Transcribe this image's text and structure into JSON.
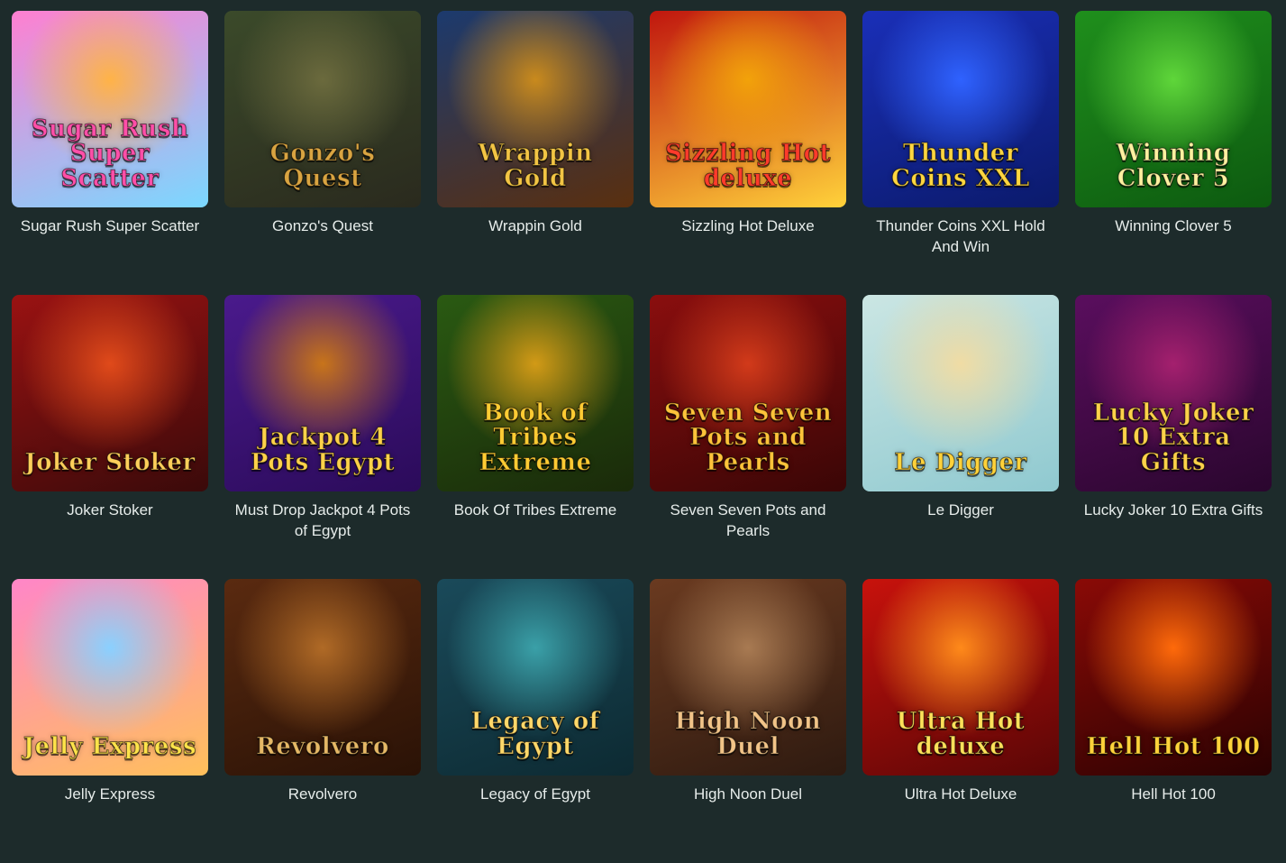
{
  "games": [
    {
      "title": "Sugar Rush Super Scatter",
      "logo": "Sugar Rush Super Scatter",
      "icon": "candy-sun-icon",
      "colors": [
        "#ff7fd0",
        "#ffb347",
        "#7ad8ff"
      ],
      "logo_color": "#ff4fa8"
    },
    {
      "title": "Gonzo's Quest",
      "logo": "Gonzo's Quest",
      "icon": "explorer-icon",
      "colors": [
        "#3b4a2a",
        "#6b6a3d",
        "#2a2a1e"
      ],
      "logo_color": "#d9a441"
    },
    {
      "title": "Wrappin Gold",
      "logo": "Wrappin Gold",
      "icon": "mummy-icon",
      "colors": [
        "#1c3a6e",
        "#c98a1d",
        "#5a2f0f"
      ],
      "logo_color": "#f3c544"
    },
    {
      "title": "Sizzling Hot Deluxe",
      "logo": "Sizzling Hot deluxe",
      "icon": "seven-cherries-icon",
      "colors": [
        "#c0160e",
        "#f2a20a",
        "#ffd23a"
      ],
      "logo_color": "#ff3b2b"
    },
    {
      "title": "Thunder Coins XXL Hold And Win",
      "logo": "Thunder Coins XXL",
      "icon": "lightning-coin-icon",
      "colors": [
        "#1a2fb8",
        "#2f62ff",
        "#0b1a6b"
      ],
      "logo_color": "#ffd640"
    },
    {
      "title": "Winning Clover 5",
      "logo": "Winning Clover 5",
      "icon": "clover-icon",
      "colors": [
        "#1f8f1c",
        "#5fd63a",
        "#0d5a10"
      ],
      "logo_color": "#fff1a0"
    },
    {
      "title": "Joker Stoker",
      "logo": "Joker Stoker",
      "icon": "joker-icon",
      "colors": [
        "#9a1212",
        "#e04a1a",
        "#3a0a0a"
      ],
      "logo_color": "#ffcf5a"
    },
    {
      "title": "Must Drop Jackpot 4 Pots of Egypt",
      "logo": "Jackpot 4 Pots Egypt",
      "icon": "gold-pot-icon",
      "colors": [
        "#4a1a8c",
        "#c8741a",
        "#2b0b5a"
      ],
      "logo_color": "#ffd24a"
    },
    {
      "title": "Book Of Tribes Extreme",
      "logo": "Book of Tribes Extreme",
      "icon": "book-icon",
      "colors": [
        "#2a5a12",
        "#d29a16",
        "#1a2a0a"
      ],
      "logo_color": "#ffcc33"
    },
    {
      "title": "Seven Seven Pots and Pearls",
      "logo": "Seven Seven Pots and Pearls",
      "icon": "seven-icon",
      "colors": [
        "#8a0e0e",
        "#d23a1a",
        "#3a0606"
      ],
      "logo_color": "#ffc33a"
    },
    {
      "title": "Le Digger",
      "logo": "Le Digger",
      "icon": "raccoon-icon",
      "colors": [
        "#cbe6e3",
        "#f0dca4",
        "#8fc9d0"
      ],
      "logo_color": "#ffd23a"
    },
    {
      "title": "Lucky Joker 10 Extra Gifts",
      "logo": "Lucky Joker 10 Extra Gifts",
      "icon": "joker-lady-icon",
      "colors": [
        "#5a0e5e",
        "#a4206e",
        "#2a062e"
      ],
      "logo_color": "#ffd24a"
    },
    {
      "title": "Jelly Express",
      "logo": "Jelly Express",
      "icon": "candy-train-icon",
      "colors": [
        "#ff86c8",
        "#8ad0ff",
        "#ffc05a"
      ],
      "logo_color": "#ffe34a"
    },
    {
      "title": "Revolvero",
      "logo": "Revolvero",
      "icon": "bandit-icon",
      "colors": [
        "#5a2a10",
        "#b06a26",
        "#2a1206"
      ],
      "logo_color": "#e6b866"
    },
    {
      "title": "Legacy of Egypt",
      "logo": "Legacy of Egypt",
      "icon": "scarab-icon",
      "colors": [
        "#1a4a5a",
        "#3aa0a8",
        "#0d2a32"
      ],
      "logo_color": "#ffd86a"
    },
    {
      "title": "High Noon Duel",
      "logo": "High Noon Duel",
      "icon": "clock-icon",
      "colors": [
        "#6a3a20",
        "#a87a52",
        "#2e1a10"
      ],
      "logo_color": "#f2c488"
    },
    {
      "title": "Ultra Hot Deluxe",
      "logo": "Ultra Hot deluxe",
      "icon": "fruits-fire-icon",
      "colors": [
        "#c8120c",
        "#ff8a1a",
        "#5a0606"
      ],
      "logo_color": "#ffe15a"
    },
    {
      "title": "Hell Hot 100",
      "logo": "Hell Hot 100",
      "icon": "fire-seven-icon",
      "colors": [
        "#8a0a06",
        "#ff6a0a",
        "#2a0202"
      ],
      "logo_color": "#ffd23a"
    }
  ]
}
